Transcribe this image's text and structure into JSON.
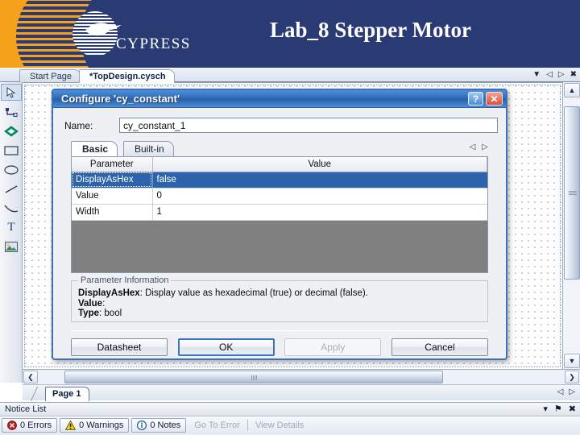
{
  "banner": {
    "title": "Lab_8 Stepper Motor",
    "logo_text": "CYPRESS",
    "bg_color": "#2a3b73",
    "accent_color": "#f5a11b"
  },
  "tabstrip": {
    "tabs": [
      {
        "label": "Start Page",
        "active": false
      },
      {
        "label": "*TopDesign.cysch",
        "active": true
      }
    ],
    "controls": {
      "dropdown": "▼",
      "prev": "◁",
      "next": "▷",
      "close": "✖"
    }
  },
  "toolbar": {
    "items": [
      {
        "name": "select-pointer-tool",
        "selected": true
      },
      {
        "name": "wire-tool",
        "selected": false
      },
      {
        "name": "component-tool",
        "selected": false
      },
      {
        "name": "rectangle-tool",
        "selected": false
      },
      {
        "name": "ellipse-tool",
        "selected": false
      },
      {
        "name": "line-tool",
        "selected": false
      },
      {
        "name": "arc-tool",
        "selected": false
      },
      {
        "name": "text-tool",
        "selected": false,
        "glyph": "T"
      },
      {
        "name": "image-tool",
        "selected": false
      }
    ]
  },
  "scrollbars": {
    "up_arrow": "▲",
    "down_arrow": "▼",
    "left_arrow": "❮",
    "right_arrow": "❯"
  },
  "pagebar": {
    "tab_label": "Page 1",
    "prev": "◁",
    "next": "▷"
  },
  "notice_list": {
    "title": "Notice List",
    "controls": {
      "menu": "▾",
      "pin": "⚑",
      "close": "✖"
    },
    "buttons": [
      {
        "label": "0 Errors",
        "icon": "error-icon",
        "enabled": true
      },
      {
        "label": "0 Warnings",
        "icon": "warning-icon",
        "enabled": true
      },
      {
        "label": "0 Notes",
        "icon": "info-icon",
        "enabled": true
      }
    ],
    "actions": [
      {
        "label": "Go To Error",
        "enabled": false
      },
      {
        "label": "View Details",
        "enabled": false
      }
    ]
  },
  "dialog": {
    "title": "Configure 'cy_constant'",
    "help_glyph": "?",
    "close_glyph": "✕",
    "name_label": "Name:",
    "name_value": "cy_constant_1",
    "name_placeholder": "",
    "tabs": [
      {
        "label": "Basic",
        "active": true
      },
      {
        "label": "Built-in",
        "active": false
      }
    ],
    "tab_arrows": {
      "prev": "◁",
      "next": "▷"
    },
    "grid": {
      "headers": [
        "Parameter",
        "Value"
      ],
      "rows": [
        {
          "parameter": "DisplayAsHex",
          "value": "false",
          "selected": true
        },
        {
          "parameter": "Value",
          "value": "0",
          "selected": false
        },
        {
          "parameter": "Width",
          "value": "1",
          "selected": false
        }
      ],
      "selection_color": "#2d63ab"
    },
    "info": {
      "legend": "Parameter Information",
      "lines": [
        {
          "label": "DisplayAsHex",
          "text": "Display value as hexadecimal (true) or decimal (false)."
        },
        {
          "label": "Value",
          "text": ""
        },
        {
          "label": "Type",
          "text": "bool"
        }
      ]
    },
    "buttons": [
      {
        "label": "Datasheet",
        "style": "normal"
      },
      {
        "label": "OK",
        "style": "default"
      },
      {
        "label": "Apply",
        "style": "disabled"
      },
      {
        "label": "Cancel",
        "style": "normal"
      }
    ]
  }
}
